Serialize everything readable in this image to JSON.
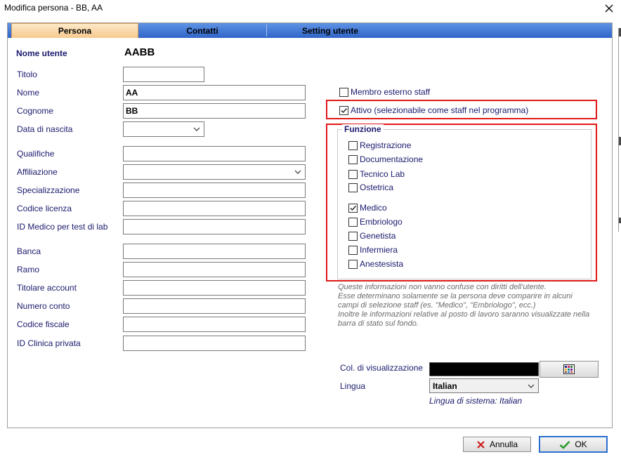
{
  "window": {
    "title": "Modifica persona - BB, AA"
  },
  "tabs": [
    {
      "label": "Persona",
      "active": true
    },
    {
      "label": "Contatti",
      "active": false
    },
    {
      "label": "Setting utente",
      "active": false
    }
  ],
  "user": {
    "label": "Nome utente",
    "value": "AABB"
  },
  "fields": {
    "titolo": {
      "label": "Titolo",
      "value": ""
    },
    "nome": {
      "label": "Nome",
      "value": "AA"
    },
    "cognome": {
      "label": "Cognome",
      "value": "BB"
    },
    "data_nascita": {
      "label": "Data di nascita",
      "value": ""
    },
    "qualifiche": {
      "label": "Qualifiche",
      "value": ""
    },
    "affiliazione": {
      "label": "Affiliazione",
      "value": ""
    },
    "specializzazione": {
      "label": "Specializzazione",
      "value": ""
    },
    "codice_licenza": {
      "label": "Codice licenza",
      "value": ""
    },
    "id_medico": {
      "label": "ID Medico per test di lab",
      "value": ""
    },
    "banca": {
      "label": "Banca",
      "value": ""
    },
    "ramo": {
      "label": "Ramo",
      "value": ""
    },
    "titolare_account": {
      "label": "Titolare account",
      "value": ""
    },
    "numero_conto": {
      "label": "Numero conto",
      "value": ""
    },
    "codice_fiscale": {
      "label": "Codice fiscale",
      "value": ""
    },
    "id_clinica": {
      "label": "ID Clinica privata",
      "value": ""
    }
  },
  "staff": {
    "membro_esterno": {
      "label": "Membro esterno staff",
      "checked": false
    },
    "attivo": {
      "label": "Attivo (selezionabile come staff nel programma)",
      "checked": true
    }
  },
  "funzione": {
    "title": "Funzione",
    "items": [
      {
        "label": "Registrazione",
        "checked": false
      },
      {
        "label": "Documentazione",
        "checked": false
      },
      {
        "label": "Tecnico Lab",
        "checked": false
      },
      {
        "label": "Ostetrica",
        "checked": false
      },
      {
        "label": "Medico",
        "checked": true
      },
      {
        "label": "Embriologo",
        "checked": false
      },
      {
        "label": "Genetista",
        "checked": false
      },
      {
        "label": "Infermiera",
        "checked": false
      },
      {
        "label": "Anestesista",
        "checked": false
      }
    ]
  },
  "note": {
    "lines": [
      "Queste informazioni non vanno confuse con diritti dell'utente.",
      "Esse determinano solamente se la persona deve comparire in alcuni",
      "campi di selezione staff (es. \"Medico\", \"Embriologo\", ecc.)",
      "Inoltre le informazioni relative al posto di lavoro saranno visualizzate nella",
      "barra di stato sul fondo."
    ]
  },
  "display": {
    "color_label": "Col. di visualizzazione",
    "color_value": "#000000",
    "lingua_label": "Lingua",
    "lingua_value": "Italian",
    "lingua_sistema": "Lingua di sistema: Italian"
  },
  "buttons": {
    "annulla": "Annulla",
    "ok": "OK"
  },
  "colors": {
    "tab_blue": "#2f64c8",
    "tab_active": "#f7c98e",
    "highlight_red": "#e01818",
    "label_navy": "#1a1a6e"
  }
}
